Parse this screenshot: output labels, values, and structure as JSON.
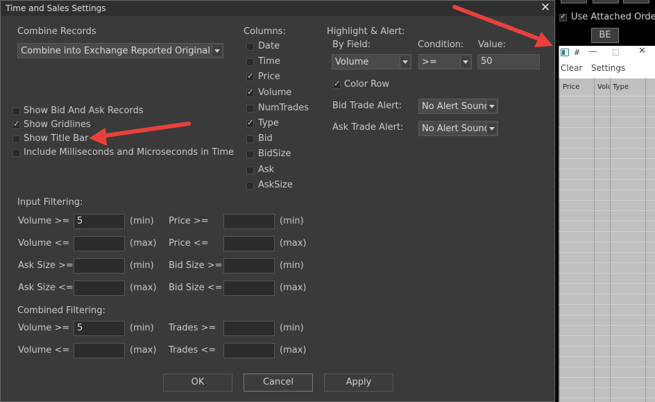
{
  "dialog": {
    "title": "Time and Sales Settings",
    "close_glyph": "✕"
  },
  "combine": {
    "label": "Combine Records",
    "value": "Combine into Exchange Reported Original Sum"
  },
  "options": [
    {
      "label": "Show Bid And Ask Records",
      "checked": false
    },
    {
      "label": "Show Gridlines",
      "checked": true
    },
    {
      "label": "Show Title Bar",
      "checked": false
    },
    {
      "label": "Include Milliseconds and Microseconds in Time",
      "checked": false
    }
  ],
  "columns": {
    "label": "Columns:",
    "items": [
      {
        "label": "Date",
        "checked": false
      },
      {
        "label": "Time",
        "checked": false
      },
      {
        "label": "Price",
        "checked": true
      },
      {
        "label": "Volume",
        "checked": true
      },
      {
        "label": "NumTrades",
        "checked": false
      },
      {
        "label": "Type",
        "checked": true
      },
      {
        "label": "Bid",
        "checked": false
      },
      {
        "label": "BidSize",
        "checked": false
      },
      {
        "label": "Ask",
        "checked": false
      },
      {
        "label": "AskSize",
        "checked": false
      }
    ]
  },
  "highlight": {
    "label": "Highlight & Alert:",
    "by_field_label": "By Field:",
    "by_field_value": "Volume",
    "condition_label": "Condition:",
    "condition_value": ">=",
    "value_label": "Value:",
    "value_value": "50",
    "color_row_label": "Color Row",
    "color_row_checked": true,
    "bid_alert_label": "Bid Trade Alert:",
    "bid_alert_value": "No Alert Sound",
    "ask_alert_label": "Ask Trade Alert:",
    "ask_alert_value": "No Alert Sound"
  },
  "input_filtering": {
    "label": "Input Filtering:",
    "rows": [
      {
        "left_label": "Volume >=",
        "left_value": "5",
        "left_unit": "(min)",
        "right_label": "Price >=",
        "right_value": "",
        "right_unit": "(min)"
      },
      {
        "left_label": "Volume <=",
        "left_value": "",
        "left_unit": "(max)",
        "right_label": "Price <=",
        "right_value": "",
        "right_unit": "(max)"
      },
      {
        "left_label": "Ask Size >=",
        "left_value": "",
        "left_unit": "(min)",
        "right_label": "Bid Size >=",
        "right_value": "",
        "right_unit": "(min)"
      },
      {
        "left_label": "Ask Size <=",
        "left_value": "",
        "left_unit": "(max)",
        "right_label": "Bid Size <=",
        "right_value": "",
        "right_unit": "(max)"
      }
    ]
  },
  "combined_filtering": {
    "label": "Combined Filtering:",
    "rows": [
      {
        "left_label": "Volume >=",
        "left_value": "5",
        "left_unit": "(min)",
        "right_label": "Trades >=",
        "right_value": "",
        "right_unit": "(min)"
      },
      {
        "left_label": "Volume <=",
        "left_value": "",
        "left_unit": "(max)",
        "right_label": "Trades <=",
        "right_value": "",
        "right_unit": "(max)"
      }
    ]
  },
  "buttons": {
    "ok": "OK",
    "cancel": "Cancel",
    "apply": "Apply"
  },
  "right_panel": {
    "use_attached_orders": "Use Attached Orders",
    "use_attached_checked": true,
    "be_button": "BE",
    "ts_window": {
      "title_glyph": "#",
      "menu_clear": "Clear",
      "menu_settings": "Settings",
      "col_price": "Price",
      "col_volume": "Volu",
      "col_type": "Type"
    }
  },
  "colors": {
    "dialog_bg": "#3a3a3a",
    "arrow": "#e8413c"
  }
}
